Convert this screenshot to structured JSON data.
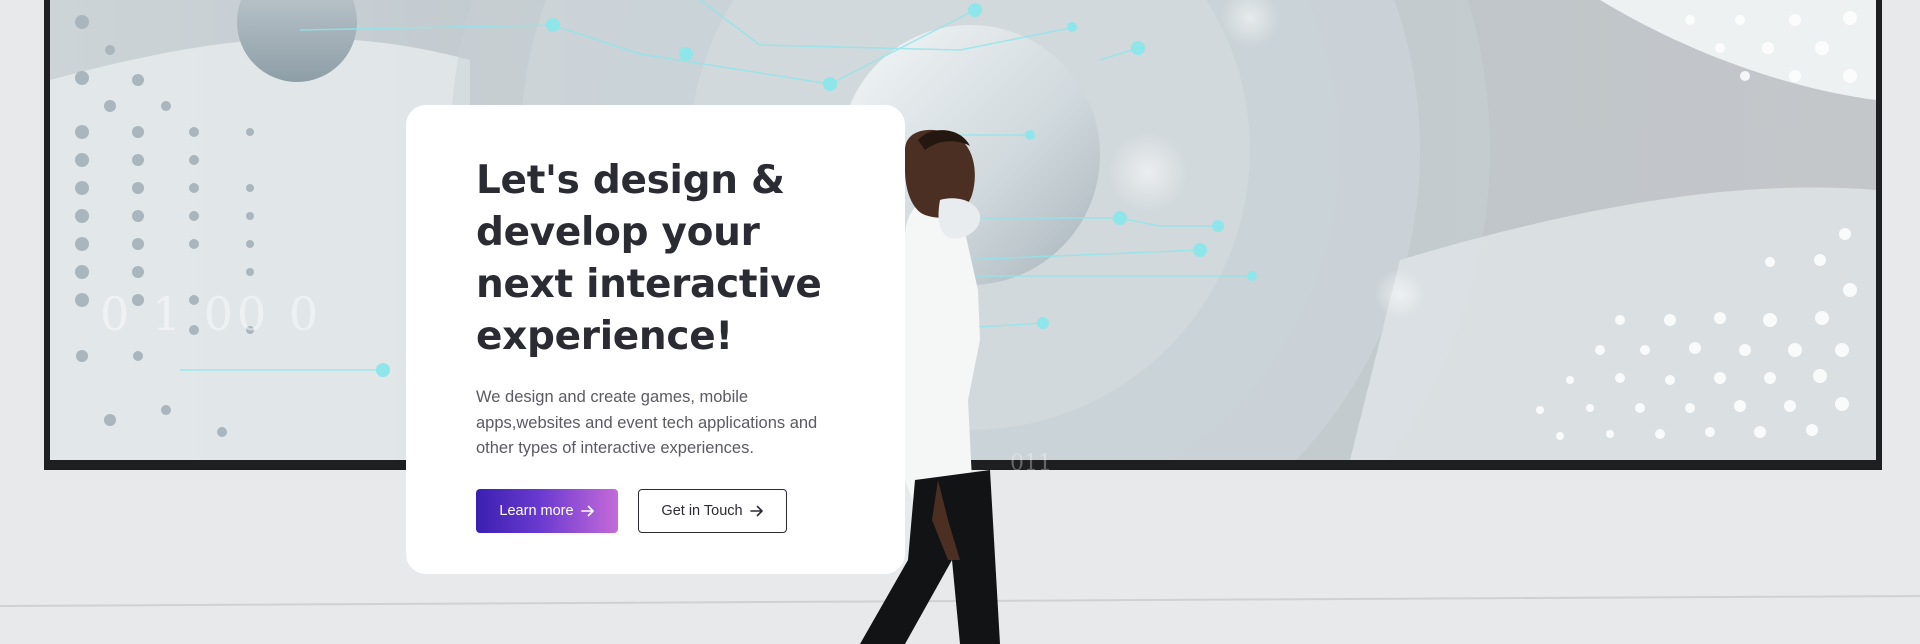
{
  "hero": {
    "headline": "Let's design & develop your next interactive experience!",
    "description": "We design and create games, mobile apps,websites and event tech applications and other types of interactive experiences.",
    "screen_digits": "0 1 00 0",
    "screen_digits_lower": "011"
  },
  "actions": {
    "learn_more": "Learn more",
    "get_in_touch": "Get in Touch"
  },
  "colors": {
    "primary_gradient_start": "#3a1fb0",
    "primary_gradient_end": "#c56ad8",
    "headline": "#2b2b33",
    "body_text": "#5a5a62",
    "card": "#ffffff"
  },
  "icons": {
    "button_arrow": "arrow-right-icon"
  }
}
